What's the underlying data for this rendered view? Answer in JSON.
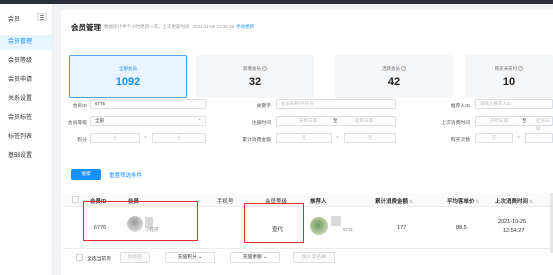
{
  "sidebar": {
    "title": "会员",
    "items": [
      {
        "label": "会员管理",
        "active": true
      },
      {
        "label": "会员等级",
        "active": false
      },
      {
        "label": "会员申请",
        "active": false
      },
      {
        "label": "关系设置",
        "active": false
      },
      {
        "label": "会员标签",
        "active": false
      },
      {
        "label": "标签列表",
        "active": false
      },
      {
        "label": "基础设置",
        "active": false
      }
    ]
  },
  "header": {
    "title": "会员管理",
    "subtitle": "数据统计半个小时更新一次，上次更新时间",
    "updated_at": "2021-11-09 15:36:48",
    "refresh_label": "手动更新"
  },
  "stats": [
    {
      "label": "全部会员",
      "value": "1092",
      "active": true
    },
    {
      "label": "新增会员",
      "value": "32",
      "active": false
    },
    {
      "label": "活跃会员",
      "value": "42",
      "active": false
    },
    {
      "label": "购买未支付",
      "value": "10",
      "active": false
    }
  ],
  "filters": {
    "member_id_label": "会员ID",
    "member_id_value": "6776",
    "keyword_label": "关键字",
    "keyword_placeholder": "会员昵称/手机号",
    "referrer_label": "推荐人ID",
    "referrer_placeholder": "请输入推荐人ID",
    "level_label": "会员等级",
    "level_value": "全部",
    "register_label": "注册时间",
    "start_placeholder": "开始日期",
    "date_sep": "至",
    "end_placeholder": "结束日期",
    "last_consume_label": "上次消费时间",
    "points_label": "积分",
    "points_unit": "分",
    "tilde": "~",
    "total_spent_label": "累计消费金额",
    "money_unit": "元",
    "buy_count_label": "购买次数",
    "count_unit": "次"
  },
  "actions": {
    "search_label": "搜索",
    "reset_label": "重置筛选条件"
  },
  "table": {
    "columns": {
      "id": "会员ID",
      "member": "会员",
      "phone": "手机号",
      "level": "会员等级",
      "referrer": "推荐人",
      "total_spent": "累计消费金额",
      "avg_price": "平均客单价",
      "last_time": "上次消费时间"
    },
    "sort_icon": "⇅",
    "rows": [
      {
        "id": "6776",
        "source": "小程序",
        "phone": "",
        "level": "壹代",
        "referrer_id": "6731",
        "total_spent": "177",
        "avg_price": "88.5",
        "last_date": "2021-10-25",
        "last_clock": "12:54:27"
      }
    ]
  },
  "bottom": {
    "select_all": "全选当前页",
    "btn_add_tag": "加标签",
    "btn_recharge_points": "充值积分",
    "btn_recharge_balance": "充值余额",
    "btn_blacklist": "加入黑名单"
  },
  "colors": {
    "primary": "#1890ff",
    "highlight_box": "#e0302a"
  }
}
